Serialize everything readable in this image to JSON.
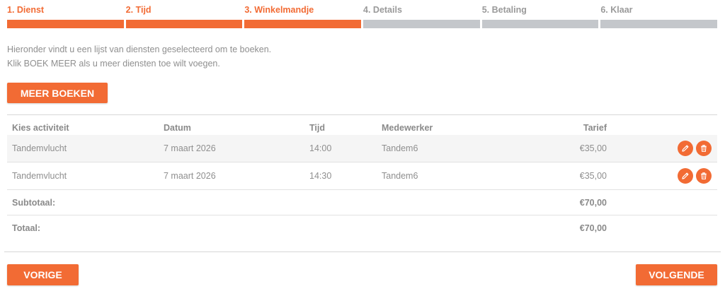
{
  "steps": [
    {
      "label": "1. Dienst",
      "state": "active"
    },
    {
      "label": "2. Tijd",
      "state": "active"
    },
    {
      "label": "3. Winkelmandje",
      "state": "active"
    },
    {
      "label": "4. Details",
      "state": "inactive"
    },
    {
      "label": "5. Betaling",
      "state": "inactive"
    },
    {
      "label": "6. Klaar",
      "state": "inactive"
    }
  ],
  "intro": {
    "line1": "Hieronder vindt u een lijst van diensten geselecteerd om te boeken.",
    "line2": "Klik BOEK MEER als u meer diensten toe wilt voegen."
  },
  "meer_boeken_label": "MEER BOEKEN",
  "table": {
    "headers": {
      "activity": "Kies activiteit",
      "date": "Datum",
      "time": "Tijd",
      "employee": "Medewerker",
      "rate": "Tarief"
    },
    "rows": [
      {
        "activity": "Tandemvlucht",
        "date": "7 maart 2026",
        "time": "14:00",
        "employee": "Tandem6",
        "rate": "€35,00"
      },
      {
        "activity": "Tandemvlucht",
        "date": "7 maart 2026",
        "time": "14:30",
        "employee": "Tandem6",
        "rate": "€35,00"
      }
    ],
    "subtotal": {
      "label": "Subtotaal:",
      "value": "€70,00"
    },
    "total": {
      "label": "Totaal:",
      "value": "€70,00"
    }
  },
  "nav": {
    "prev_label": "VORIGE",
    "next_label": "VOLGENDE"
  },
  "colors": {
    "accent": "#f26b34",
    "inactive_bar": "#c4c7cb",
    "text": "#8f8f8f"
  },
  "icons": {
    "edit": "pencil-icon",
    "delete": "trash-icon"
  }
}
